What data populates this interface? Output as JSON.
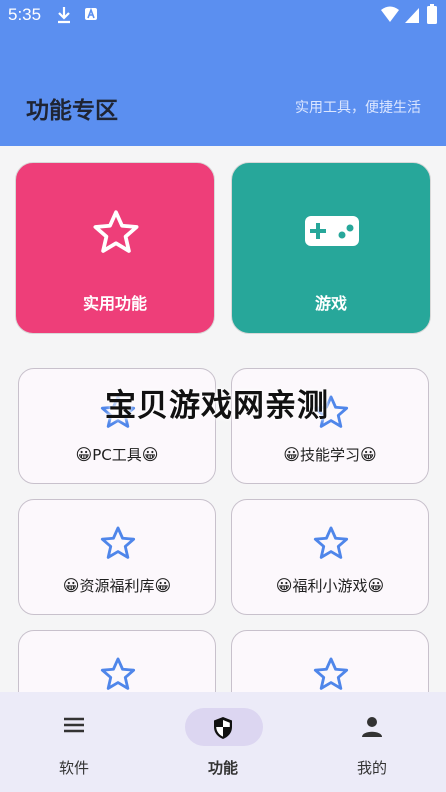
{
  "status_bar": {
    "time": "5:35"
  },
  "header": {
    "title": "功能专区",
    "subtitle": "实用工具，便捷生活"
  },
  "feature_cards": [
    {
      "label": "实用功能",
      "icon": "star-icon",
      "color": "#ee3e79"
    },
    {
      "label": "游戏",
      "icon": "gamepad-icon",
      "color": "#27a79a"
    }
  ],
  "items": [
    {
      "label": "PC工具"
    },
    {
      "label": "技能学习"
    },
    {
      "label": "资源福利库"
    },
    {
      "label": "福利小游戏"
    },
    {
      "label": ""
    },
    {
      "label": ""
    }
  ],
  "watermark": "宝贝游戏网亲测",
  "bottom_nav": [
    {
      "label": "软件",
      "icon": "menu-icon"
    },
    {
      "label": "功能",
      "icon": "shield-icon",
      "active": true
    },
    {
      "label": "我的",
      "icon": "person-icon"
    }
  ],
  "colors": {
    "header": "#5b8ff0",
    "star_outline": "#4f86ea"
  }
}
